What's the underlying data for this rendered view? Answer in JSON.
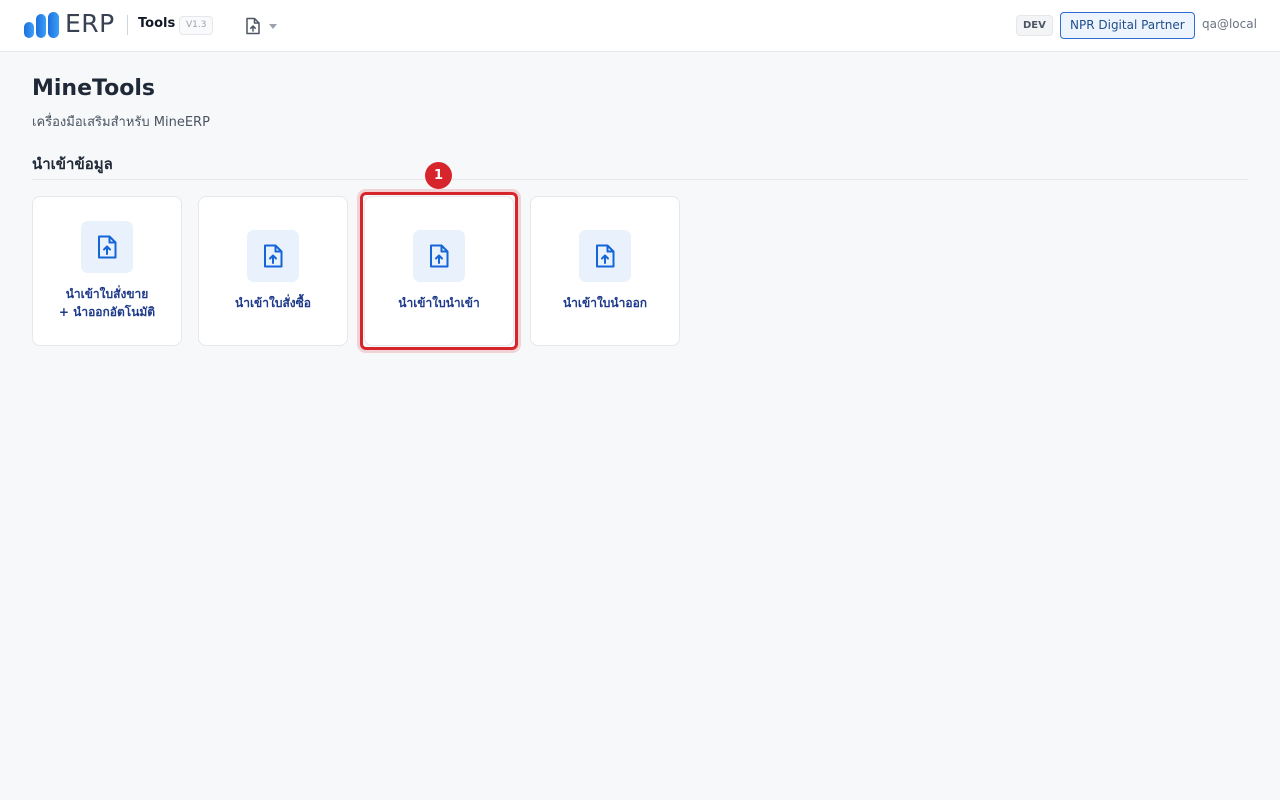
{
  "header": {
    "brand": "ERP",
    "app_name": "Tools",
    "version": "V1.3",
    "nav_icon": "file-upload-icon",
    "env_badge": "DEV",
    "org_button": "NPR Digital Partner",
    "user": "qa@local"
  },
  "page": {
    "title": "MineTools",
    "subtitle": "เครื่องมือเสริมสำหรับ MineERP"
  },
  "section": {
    "title": "นำเข้าข้อมูล"
  },
  "cards": [
    {
      "label": "นำเข้าใบสั่งขาย\n+ นำออกอัตโนมัติ",
      "icon": "file-upload-icon"
    },
    {
      "label": "นำเข้าใบสั่งซื้อ",
      "icon": "file-upload-icon"
    },
    {
      "label": "นำเข้าใบนำเข้า",
      "icon": "file-upload-icon"
    },
    {
      "label": "นำเข้าใบนำออก",
      "icon": "file-upload-icon"
    }
  ],
  "annotation": {
    "step": "1",
    "target_card_index": 2
  },
  "colors": {
    "accent": "#2f6bd0",
    "card_label": "#1e3a8a",
    "icon_bg": "#e8f1fc",
    "highlight": "#d7262b"
  }
}
